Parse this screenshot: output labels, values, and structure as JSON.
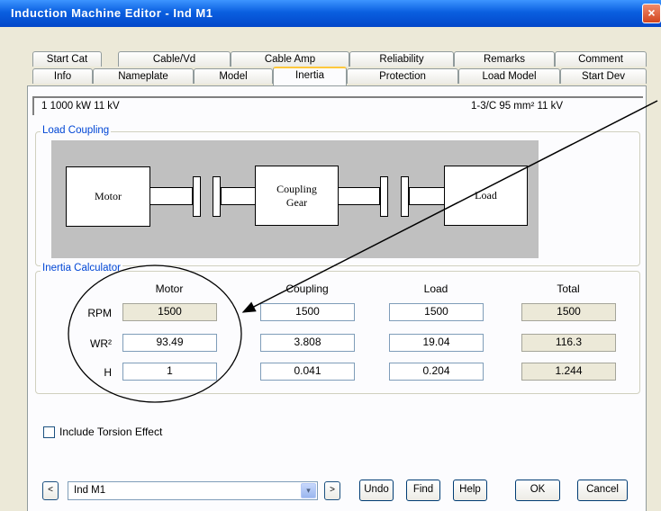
{
  "window": {
    "title": "Induction Machine Editor - Ind M1",
    "close_glyph": "×"
  },
  "tabs_row1": [
    "Start Cat",
    "Cable/Vd",
    "Cable Amp",
    "Reliability",
    "Remarks",
    "Comment"
  ],
  "tabs_row2": [
    "Info",
    "Nameplate",
    "Model",
    "Inertia",
    "Protection",
    "Load Model",
    "Start Dev"
  ],
  "active_tab": "Inertia",
  "info_bar": {
    "left": "1   1000 kW   11 kV",
    "right": "1-3/C   95 mm²   11 kV"
  },
  "load_coupling": {
    "legend": "Load Coupling",
    "motor_label": "Motor",
    "coupling_label_1": "Coupling",
    "coupling_label_2": "Gear",
    "load_label": "Load"
  },
  "inertia_calculator": {
    "legend": "Inertia Calculator",
    "columns": [
      "Motor",
      "Coupling",
      "Load",
      "Total"
    ],
    "rows": [
      {
        "label": "RPM",
        "values": [
          "1500",
          "1500",
          "1500",
          "1500"
        ]
      },
      {
        "label": "WR²",
        "values": [
          "93.49",
          "3.808",
          "19.04",
          "116.3"
        ]
      },
      {
        "label": "H",
        "values": [
          "1",
          "0.041",
          "0.204",
          "1.244"
        ]
      }
    ]
  },
  "torsion": {
    "label": "Include Torsion Effect",
    "checked": false
  },
  "bottom": {
    "prev_label": "<",
    "next_label": ">",
    "combo_value": "Ind M1",
    "combo_arrow": "▾",
    "undo": "Undo",
    "find": "Find",
    "help": "Help",
    "ok": "OK",
    "cancel": "Cancel"
  }
}
